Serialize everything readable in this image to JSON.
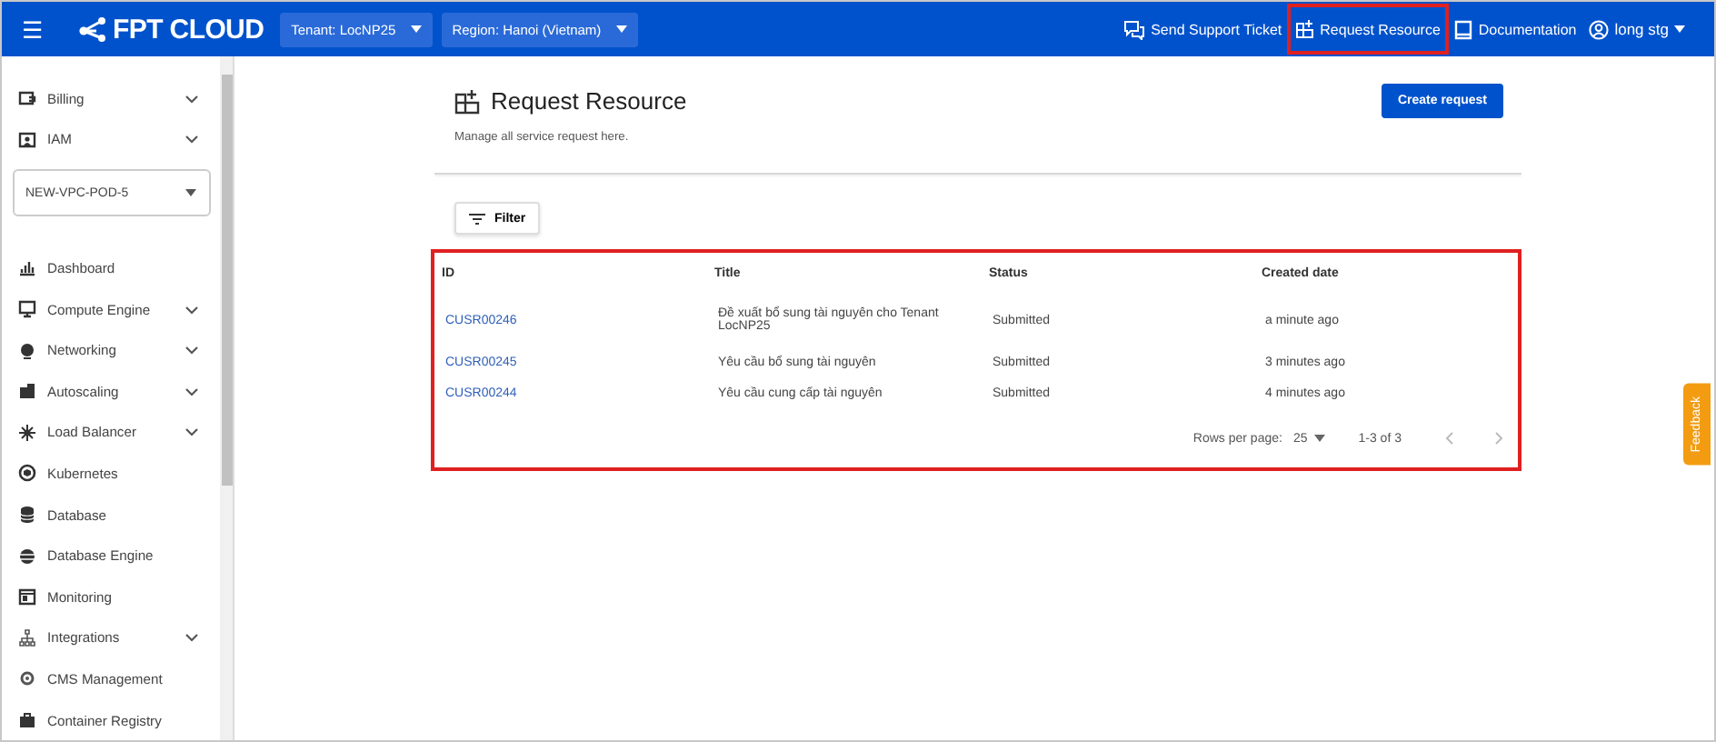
{
  "topbar": {
    "logo": "FPT CLOUD",
    "menu_icon": "☰",
    "selectors": [
      {
        "label": "Tenant: LocNP25"
      },
      {
        "label": "Region: Hanoi (Vietnam)"
      }
    ],
    "links": [
      {
        "label": "Send Support Ticket",
        "highlighted": false
      },
      {
        "label": "Request Resource",
        "highlighted": true
      },
      {
        "label": "Documentation",
        "highlighted": false
      }
    ],
    "user": "long stg"
  },
  "sidebar": {
    "top_items": [
      {
        "label": "Billing",
        "expandable": true
      },
      {
        "label": "IAM",
        "expandable": true
      }
    ],
    "project_select": "NEW-VPC-POD-5",
    "items": [
      {
        "label": "Dashboard",
        "expandable": false
      },
      {
        "label": "Compute Engine",
        "expandable": true
      },
      {
        "label": "Networking",
        "expandable": true
      },
      {
        "label": "Autoscaling",
        "expandable": true
      },
      {
        "label": "Load Balancer",
        "expandable": true
      },
      {
        "label": "Kubernetes",
        "expandable": false
      },
      {
        "label": "Database",
        "expandable": false
      },
      {
        "label": "Database Engine",
        "expandable": false
      },
      {
        "label": "Monitoring",
        "expandable": false
      },
      {
        "label": "Integrations",
        "expandable": true
      },
      {
        "label": "CMS Management",
        "expandable": false
      },
      {
        "label": "Container Registry",
        "expandable": false
      }
    ]
  },
  "page": {
    "title": "Request Resource",
    "subtitle": "Manage all service request here.",
    "create_button": "Create request",
    "filter_button": "Filter"
  },
  "table": {
    "highlighted": true,
    "columns": [
      "ID",
      "Title",
      "Status",
      "Created date"
    ],
    "rows": [
      [
        "CUSR00246",
        "Đề xuất bổ sung tài nguyên cho Tenant LocNP25",
        "Submitted",
        "a minute ago"
      ],
      [
        "CUSR00245",
        "Yêu cầu bổ sung tài nguyên",
        "Submitted",
        "3 minutes ago"
      ],
      [
        "CUSR00244",
        "Yêu cầu cung cấp tài nguyên",
        "Submitted",
        "4 minutes ago"
      ]
    ],
    "footer": {
      "rows_per_page_label": "Rows per page:",
      "rows_per_page": "25",
      "range": "1-3 of 3"
    }
  },
  "feedback": "Feedback"
}
